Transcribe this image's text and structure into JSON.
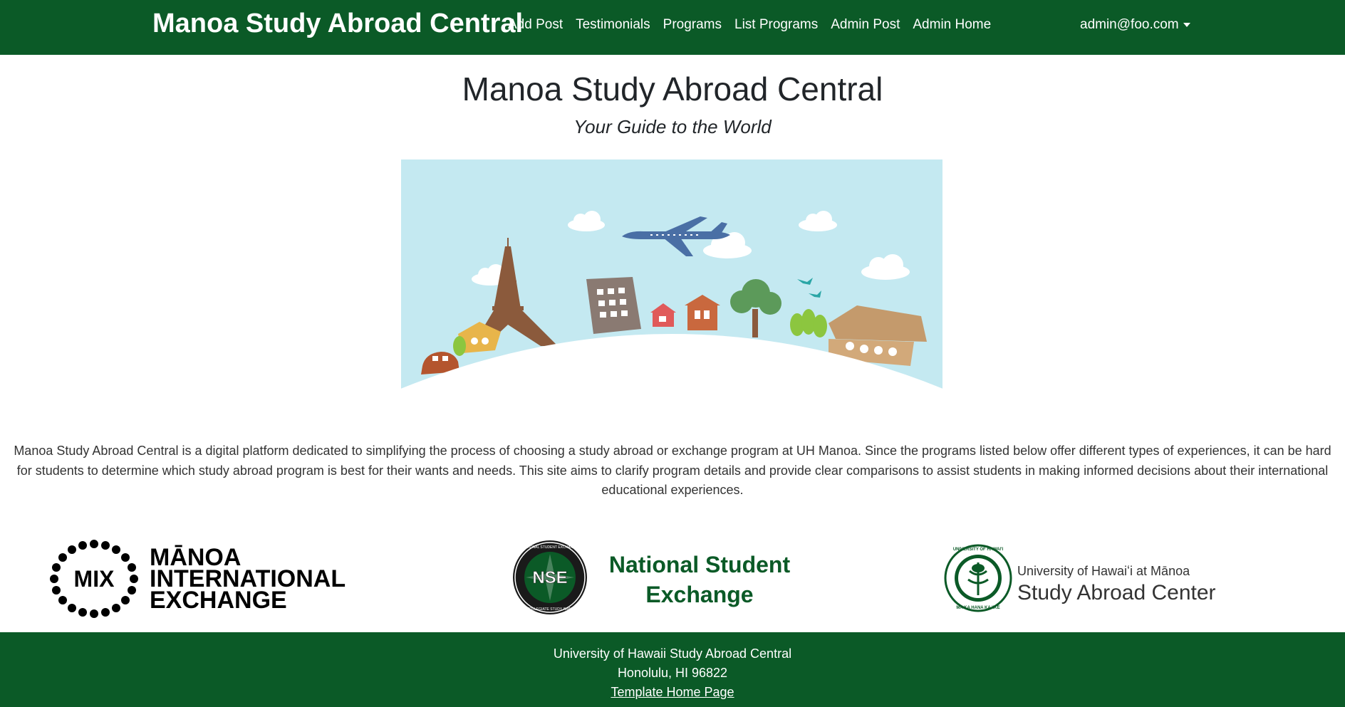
{
  "navbar": {
    "brand": "Manoa Study Abroad Central",
    "links": [
      "Add Post",
      "Testimonials",
      "Programs",
      "List Programs",
      "Admin Post",
      "Admin Home"
    ],
    "user": "admin@foo.com",
    "background": "#0b5a27"
  },
  "hero": {
    "title": "Manoa Study Abroad Central",
    "subtitle": "Your Guide to the World"
  },
  "description": "Manoa Study Abroad Central is a digital platform dedicated to simplifying the process of choosing a study abroad or exchange program at UH Manoa. Since the programs listed below offer different types of experiences, it can be hard for students to determine which study abroad program is best for their wants and needs. This site aims to clarify program details and provide clear comparisons to assist students in making informed decisions about their international educational experiences.",
  "logos": {
    "mix": {
      "badge": "MIX",
      "line1": "MĀNOA",
      "line2": "INTERNATIONAL",
      "line3": "EXCHANGE"
    },
    "nse": {
      "badge": "NSE",
      "ring_top": "NATIONAL STUDENT EXCHANGE",
      "ring_bottom": "COLLEGIATE STUDY AWAY",
      "line1": "National Student",
      "line2": "Exchange",
      "color": "#0b5a27"
    },
    "uh": {
      "ring_top": "UNIVERSITY OF HAWAI'I",
      "ring_bottom": "MA KA HANA KA 'IKE",
      "line1": "University of Hawaiʻi at Mānoa",
      "line2": "Study Abroad Center",
      "color": "#0b5a27"
    }
  },
  "footer": {
    "line1": "University of Hawaii Study Abroad Central",
    "line2": "Honolulu, HI 96822",
    "link": "Template Home Page"
  },
  "colors": {
    "primary_green": "#0b5a27",
    "sky": "#c4e9f1"
  }
}
